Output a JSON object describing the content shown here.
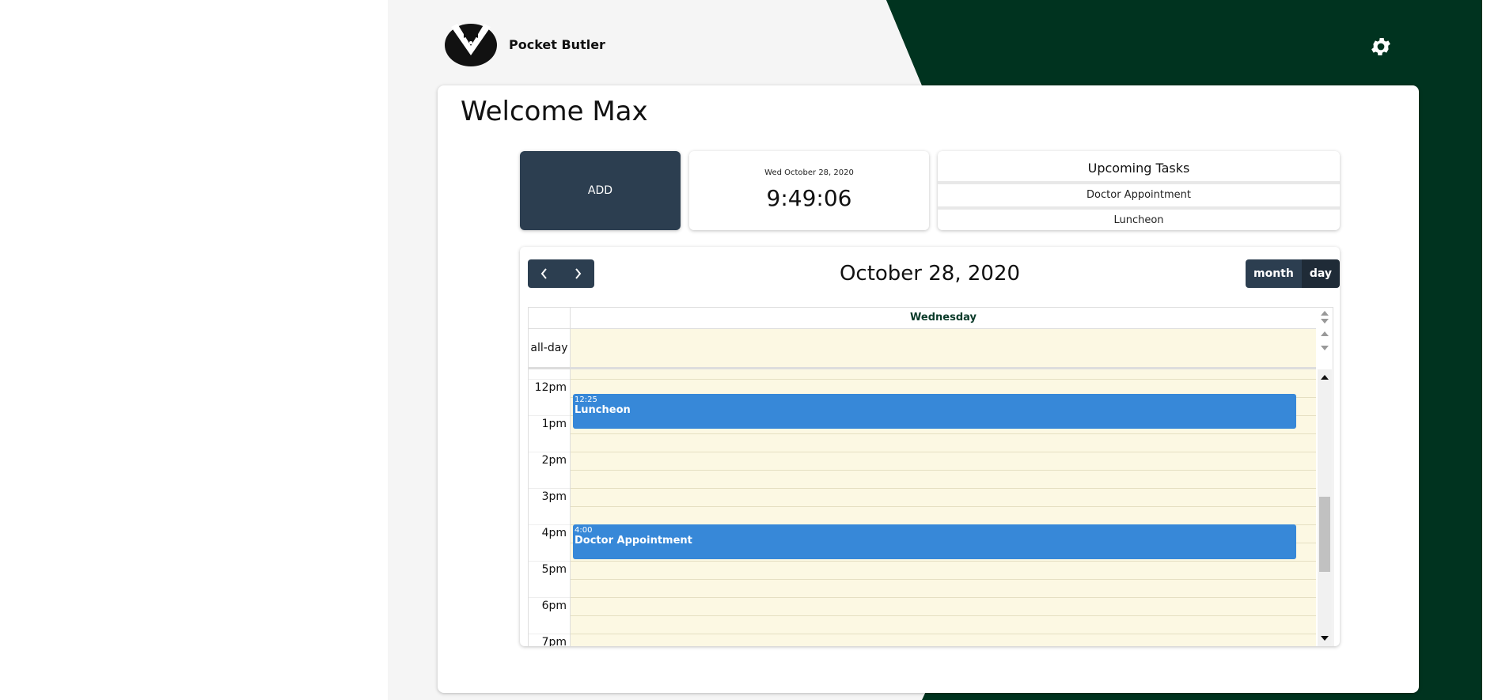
{
  "app": {
    "brand": "Pocket Butler",
    "welcome": "Welcome Max"
  },
  "colors": {
    "dark_green": "#00331f",
    "nav_dark": "#2c3e50",
    "event_blue": "#3788d8",
    "calendar_bg": "#fcf8e3"
  },
  "icons": {
    "logo": "butler-tuxedo-logo",
    "settings": "gear-icon",
    "prev": "chevron-left-icon",
    "next": "chevron-right-icon"
  },
  "widgets": {
    "add_label": "ADD",
    "clock_date": "Wed October 28, 2020",
    "clock_time": "9:49:06",
    "tasks_title": "Upcoming Tasks",
    "tasks": [
      "Doctor Appointment",
      "Luncheon"
    ]
  },
  "calendar": {
    "title": "October 28, 2020",
    "views": {
      "month": "month",
      "day": "day"
    },
    "active_view": "day",
    "day_header": "Wednesday",
    "allday_label": "all-day",
    "hours": [
      "12pm",
      "1pm",
      "2pm",
      "3pm",
      "4pm",
      "5pm",
      "6pm",
      "7pm"
    ],
    "events": [
      {
        "time": "12:25",
        "title": "Luncheon"
      },
      {
        "time": "4:00",
        "title": "Doctor Appointment"
      }
    ]
  }
}
